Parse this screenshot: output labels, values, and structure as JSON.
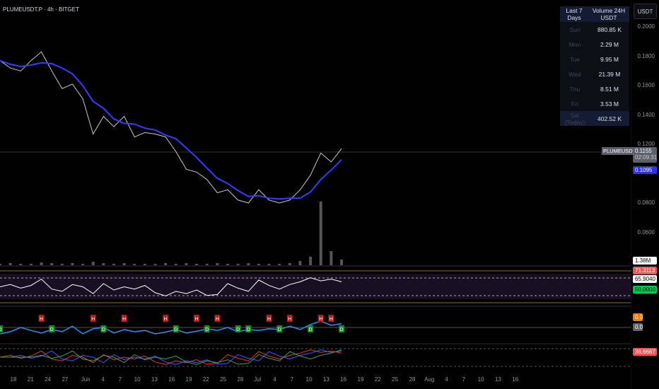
{
  "header": {
    "title": "PLUMEUSDT.P · 4h · BITGET"
  },
  "currency_button": "USDT",
  "volume_table": {
    "headers": [
      "Last 7 Days",
      "Volume 24H USDT"
    ],
    "rows": [
      {
        "day": "Sun",
        "value": "880.85 K"
      },
      {
        "day": "Mon",
        "value": "2.29 M"
      },
      {
        "day": "Tue",
        "value": "9.95 M"
      },
      {
        "day": "Wed",
        "value": "21.39 M"
      },
      {
        "day": "Thu",
        "value": "8.51 M"
      },
      {
        "day": "Fri",
        "value": "3.53 M"
      },
      {
        "day": "Sat (Today)",
        "value": "402.52 K"
      }
    ]
  },
  "price_axis": [
    "0.2000",
    "0.1800",
    "0.1600",
    "0.1400",
    "0.1200",
    "0.0800",
    "0.0600"
  ],
  "tags": {
    "symbol": "PLUMEUSDT.P",
    "last_price": "0.1155",
    "countdown": "02:09:31",
    "ma_value": "0.1095",
    "volume": "1.38M",
    "rsi_upper": "71.3113",
    "rsi_value": "65.9040",
    "rsi_mid": "50.0000",
    "osc_1": "0.0",
    "osc_2": "0.0",
    "stoch_value": "36.6667"
  },
  "time_axis": [
    "18",
    "21",
    "24",
    "27",
    "Jun",
    "4",
    "7",
    "10",
    "13",
    "16",
    "19",
    "22",
    "25",
    "28",
    "Jul",
    "4",
    "7",
    "10",
    "13",
    "16",
    "19",
    "22",
    "25",
    "28",
    "Aug",
    "4",
    "7",
    "10",
    "13",
    "16"
  ],
  "colors": {
    "ma": "#3b3bff",
    "rsi_up": "#ffffff",
    "rsi_down": "#f05454",
    "high": "#b71c1c",
    "low": "#1b8a2e",
    "osc": "#2196f3"
  },
  "chart_data": {
    "type": "line",
    "price": [
      0.177,
      0.172,
      0.17,
      0.177,
      0.183,
      0.17,
      0.158,
      0.161,
      0.151,
      0.127,
      0.139,
      0.132,
      0.139,
      0.125,
      0.128,
      0.127,
      0.125,
      0.115,
      0.103,
      0.101,
      0.096,
      0.087,
      0.089,
      0.082,
      0.08,
      0.089,
      0.082,
      0.08,
      0.082,
      0.089,
      0.099,
      0.114,
      0.108,
      0.117
    ],
    "volume": [
      2,
      3,
      2,
      2,
      4,
      3,
      2,
      3,
      2,
      5,
      3,
      2,
      3,
      2,
      2,
      2,
      3,
      2,
      3,
      2,
      2,
      3,
      2,
      2,
      3,
      2,
      2,
      2,
      3,
      6,
      12,
      90,
      20,
      8
    ],
    "rsi": [
      55,
      60,
      52,
      58,
      72,
      50,
      45,
      60,
      55,
      40,
      62,
      48,
      55,
      50,
      58,
      42,
      35,
      45,
      40,
      48,
      36,
      38,
      62,
      52,
      45,
      70,
      58,
      50,
      60,
      66,
      75,
      68,
      72,
      66
    ],
    "osc": [
      40,
      45,
      55,
      48,
      42,
      50,
      45,
      58,
      40,
      52,
      55,
      42,
      50,
      45,
      48,
      40,
      44,
      50,
      42,
      46,
      52,
      48,
      55,
      45,
      50,
      48,
      52,
      50,
      58,
      50,
      62,
      70,
      60,
      64
    ],
    "markers": [
      {
        "i": 0,
        "t": "D"
      },
      {
        "i": 4,
        "t": "H"
      },
      {
        "i": 5,
        "t": "D"
      },
      {
        "i": 9,
        "t": "H"
      },
      {
        "i": 10,
        "t": "D"
      },
      {
        "i": 12,
        "t": "H"
      },
      {
        "i": 16,
        "t": "H"
      },
      {
        "i": 17,
        "t": "D"
      },
      {
        "i": 19,
        "t": "H"
      },
      {
        "i": 20,
        "t": "D"
      },
      {
        "i": 21,
        "t": "H"
      },
      {
        "i": 23,
        "t": "D"
      },
      {
        "i": 24,
        "t": "D"
      },
      {
        "i": 26,
        "t": "H"
      },
      {
        "i": 27,
        "t": "D"
      },
      {
        "i": 28,
        "t": "H"
      },
      {
        "i": 30,
        "t": "D"
      },
      {
        "i": 31,
        "t": "H"
      },
      {
        "i": 32,
        "t": "H"
      },
      {
        "i": 33,
        "t": "D"
      }
    ],
    "ylim": [
      0.05,
      0.21
    ]
  }
}
